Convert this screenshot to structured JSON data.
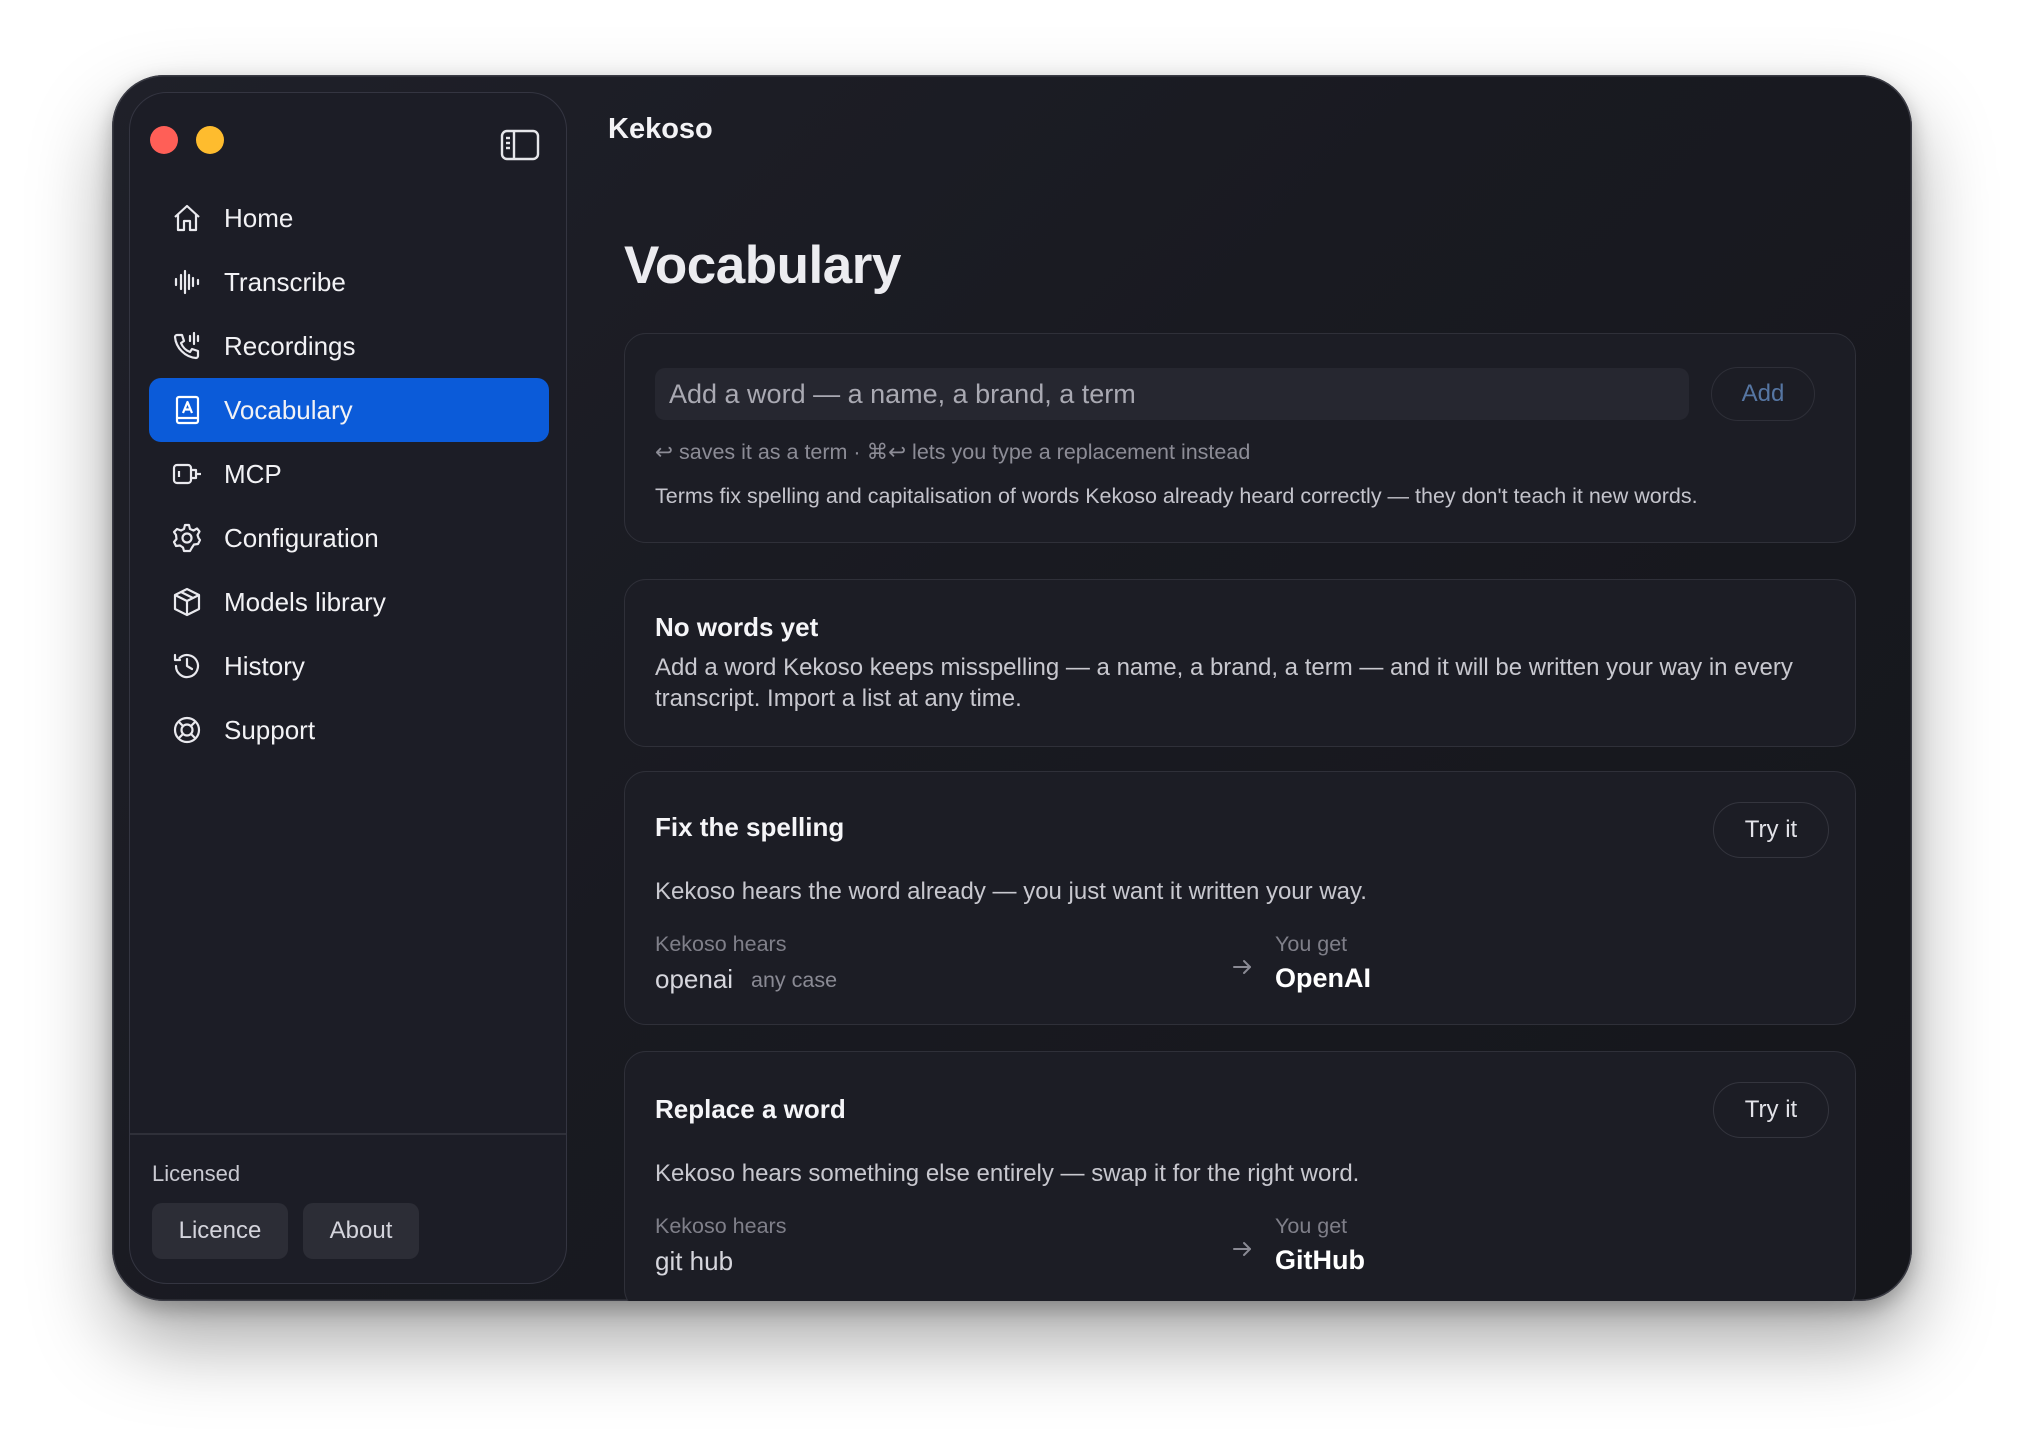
{
  "app": {
    "title": "Kekoso"
  },
  "sidebar": {
    "items": [
      {
        "label": "Home",
        "icon": "home-icon",
        "active": false
      },
      {
        "label": "Transcribe",
        "icon": "waveform-icon",
        "active": false
      },
      {
        "label": "Recordings",
        "icon": "phone-recording-icon",
        "active": false
      },
      {
        "label": "Vocabulary",
        "icon": "book-icon",
        "active": true
      },
      {
        "label": "MCP",
        "icon": "plug-icon",
        "active": false
      },
      {
        "label": "Configuration",
        "icon": "gear-icon",
        "active": false
      },
      {
        "label": "Models library",
        "icon": "cube-icon",
        "active": false
      },
      {
        "label": "History",
        "icon": "clock-history-icon",
        "active": false
      },
      {
        "label": "Support",
        "icon": "lifebuoy-icon",
        "active": false
      }
    ],
    "footer": {
      "status": "Licensed",
      "licence_button": "Licence",
      "about_button": "About"
    }
  },
  "page": {
    "title": "Vocabulary"
  },
  "add_word": {
    "placeholder": "Add a word — a name, a brand, a term",
    "add_button": "Add",
    "hint": "↩ saves it as a term · ⌘↩ lets you type a replacement instead",
    "note": "Terms fix spelling and capitalisation of words Kekoso already heard correctly — they don't teach it new words."
  },
  "empty_state": {
    "title": "No words yet",
    "body": "Add a word Kekoso keeps misspelling — a name, a brand, a term — and it will be written your way in every transcript. Import a list at any time."
  },
  "examples": [
    {
      "title": "Fix the spelling",
      "try_button": "Try it",
      "description": "Kekoso hears the word already — you just want it written your way.",
      "heard_label": "Kekoso hears",
      "heard": "openai",
      "heard_qualifier": "any case",
      "result_label": "You get",
      "result": "OpenAI"
    },
    {
      "title": "Replace a word",
      "try_button": "Try it",
      "description": "Kekoso hears something else entirely — swap it for the right word.",
      "heard_label": "Kekoso hears",
      "heard": "git hub",
      "result_label": "You get",
      "result": "GitHub"
    }
  ],
  "colors": {
    "accent": "#0b5bd9",
    "background": "#1a1b22",
    "close": "#ff5f57",
    "minimize": "#febc2e"
  }
}
